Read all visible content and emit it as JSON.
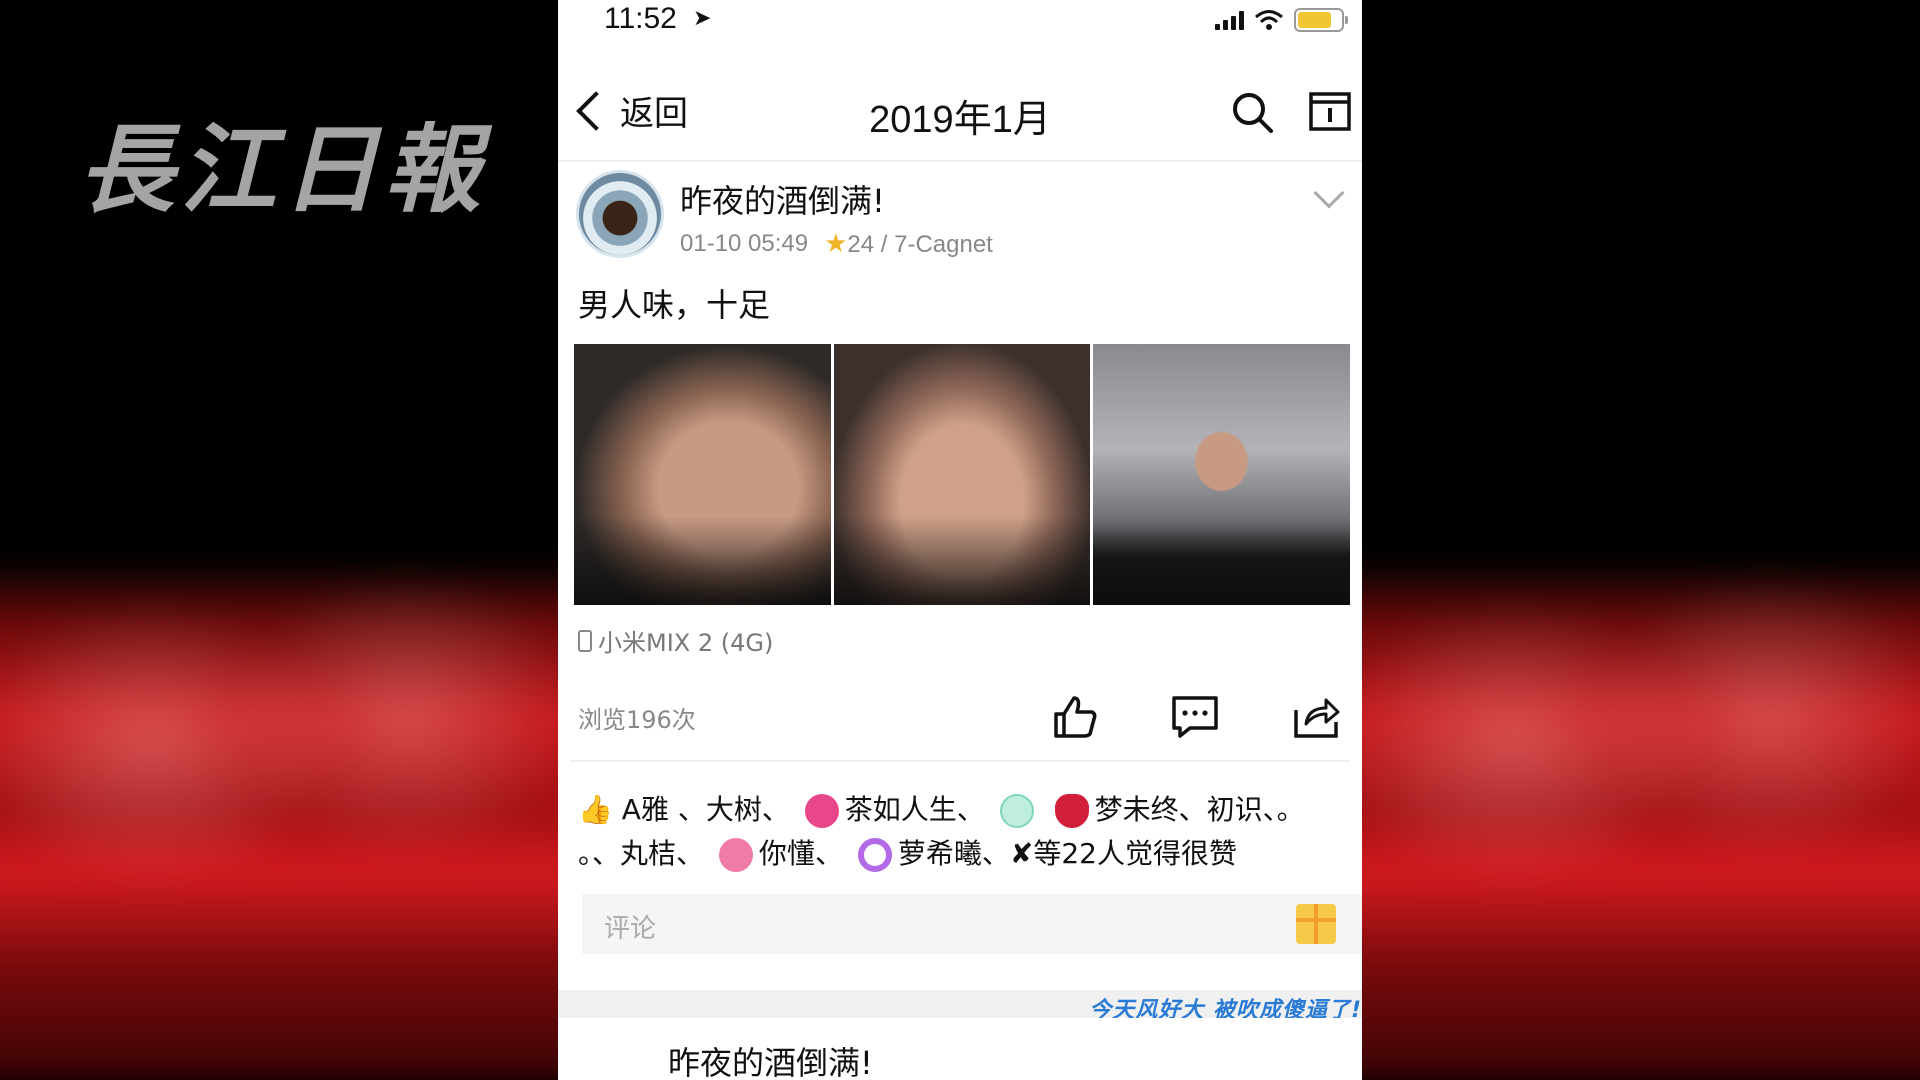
{
  "watermark": {
    "text": "長江日報"
  },
  "status_bar": {
    "time": "11:52",
    "location_arrow": "➤",
    "battery_color": "#f2c535"
  },
  "nav": {
    "back_label": "返回",
    "title": "2019年1月",
    "search_icon": "search-icon",
    "calendar_icon": "calendar-icon"
  },
  "post": {
    "username": "昨夜的酒倒满!",
    "datetime": "01-10 05:49",
    "rank_star": "★",
    "rank_text": "24 / 7-Cagnet",
    "content": "男人味，十足",
    "device_label": "小米MIX 2 (4G)",
    "views": "浏览196次"
  },
  "likes": {
    "thumb": "👍",
    "t1": "A雅",
    "t2": "、大树、",
    "t3": "茶如人生、",
    "t4": "梦未终、初识、。",
    "t5": "。、丸桔、",
    "t6": "你懂",
    "t7": "、",
    "t8": "萝希曦、",
    "t9": "✘等22人觉得很赞"
  },
  "comment": {
    "placeholder": "评论"
  },
  "banner": {
    "text": "今天风好大 被吹成傻逼了!"
  },
  "next_post": {
    "username": "昨夜的酒倒满!"
  }
}
